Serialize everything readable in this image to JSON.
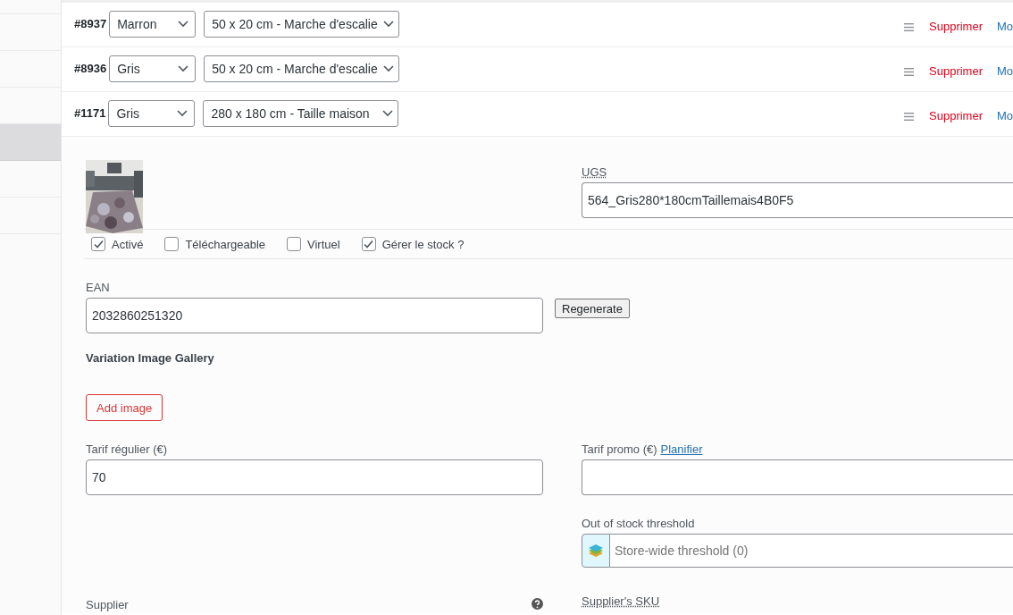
{
  "sidebar": {
    "items": [
      {
        "selected": false
      },
      {
        "selected": false
      },
      {
        "selected": false
      },
      {
        "selected": false
      },
      {
        "selected": true
      },
      {
        "selected": false
      },
      {
        "selected": false
      }
    ]
  },
  "variations": [
    {
      "id": "#8937",
      "attribute_1": "Marron",
      "attribute_2": "50 x 20 cm - Marche d'escalie",
      "delete": "Supprimer",
      "edit": "Mo"
    },
    {
      "id": "#8936",
      "attribute_1": "Gris",
      "attribute_2": "50 x 20 cm - Marche d'escalie",
      "delete": "Supprimer",
      "edit": "Mo"
    },
    {
      "id": "#1171",
      "attribute_1": "Gris",
      "attribute_2": "280 x 180 cm - Taille maison",
      "delete": "Supprimer",
      "edit": "Mo"
    }
  ],
  "panel": {
    "sku": {
      "label": "UGS",
      "value": "564_Gris280*180cmTaillemais4B0F5"
    },
    "options": [
      {
        "label": "Activé",
        "checked": true
      },
      {
        "label": "Téléchargeable",
        "checked": false
      },
      {
        "label": "Virtuel",
        "checked": false
      },
      {
        "label": "Gérer le stock ?",
        "checked": true
      }
    ],
    "ean": {
      "label": "EAN",
      "value": "2032860251320",
      "button": "Regenerate"
    },
    "gallery": {
      "title": "Variation Image Gallery",
      "button": "Add image"
    },
    "regular_price": {
      "label": "Tarif régulier (€)",
      "value": "70"
    },
    "sale_price": {
      "label": "Tarif promo (€)",
      "link": "Planifier"
    },
    "threshold": {
      "label": "Out of stock threshold",
      "placeholder": "Store-wide threshold (0)"
    },
    "supplier": {
      "label": "Supplier"
    },
    "supplier_sku": {
      "label": "Supplier's SKU"
    }
  }
}
